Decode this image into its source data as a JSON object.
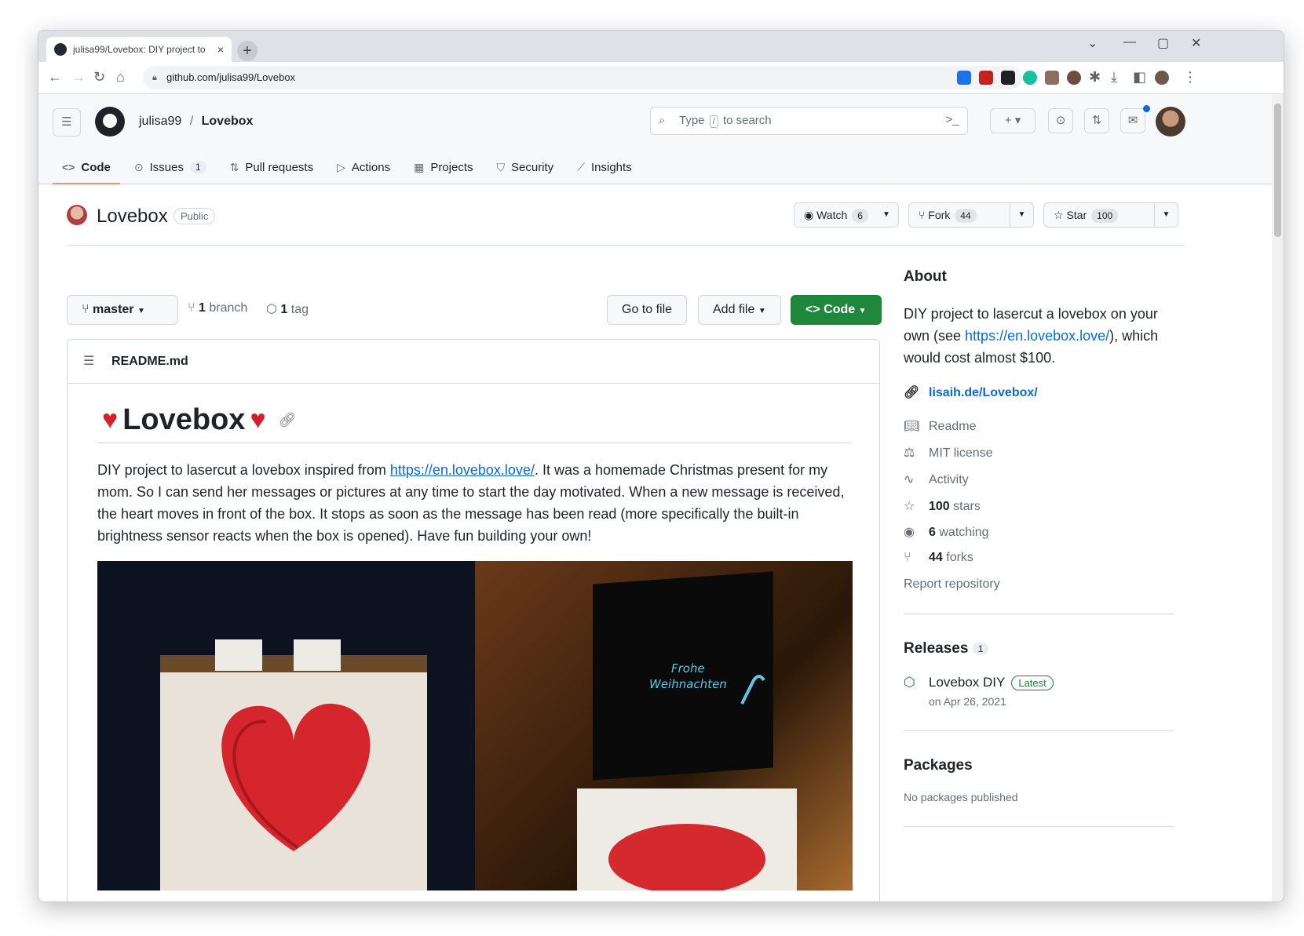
{
  "browser": {
    "tab_title": "julisa99/Lovebox: DIY project to",
    "tab_close": "×",
    "new_tab": "+",
    "url": "github.com/julisa99/Lovebox",
    "minimize": "⌄",
    "min2": "—",
    "maximize": "▢",
    "close": "✕"
  },
  "header": {
    "owner": "julisa99",
    "sep": "/",
    "repo": "Lovebox",
    "search_prefix": "Type",
    "search_kbd": "/",
    "search_suffix": "to search"
  },
  "repo_tabs": [
    {
      "icon": "<>",
      "label": "Code",
      "selected": true
    },
    {
      "icon": "⊙",
      "label": "Issues",
      "count": "1"
    },
    {
      "icon": "⇅",
      "label": "Pull requests"
    },
    {
      "icon": "▷",
      "label": "Actions"
    },
    {
      "icon": "▦",
      "label": "Projects"
    },
    {
      "icon": "⛉",
      "label": "Security"
    },
    {
      "icon": "⟋",
      "label": "Insights"
    }
  ],
  "repo": {
    "name": "Lovebox",
    "visibility": "Public",
    "watch_label": "Watch",
    "watch_count": "6",
    "fork_label": "Fork",
    "fork_count": "44",
    "star_label": "Star",
    "star_count": "100"
  },
  "filebar": {
    "branch": "master",
    "branch_count": "1",
    "branch_word": "branch",
    "tag_count": "1",
    "tag_word": "tag",
    "go_to_file": "Go to file",
    "add_file": "Add file",
    "code": "Code"
  },
  "readme": {
    "filename": "README.md",
    "title": "Lovebox",
    "para_before": "DIY project to lasercut a lovebox inspired from ",
    "para_link": "https://en.lovebox.love/",
    "para_after": ". It was a homemade Christmas present for my mom. So I can send her messages or pictures at any time to start the day motivated. When a new message is received, the heart moves in front of the box. It stops as soon as the message has been read (more specifically the built-in brightness sensor reacts when the box is opened). Have fun building your own!",
    "image_text_1": "Frohe",
    "image_text_2": "Weihnachten"
  },
  "about": {
    "heading": "About",
    "desc_before": "DIY project to lasercut a lovebox on your own (see ",
    "desc_link": "https://en.lovebox.love/",
    "desc_after": "), which would cost almost $100.",
    "website": "lisaih.de/Lovebox/",
    "readme": "Readme",
    "license": "MIT license",
    "activity": "Activity",
    "stars_count": "100",
    "stars_word": "stars",
    "watching_count": "6",
    "watching_word": "watching",
    "forks_count": "44",
    "forks_word": "forks",
    "report": "Report repository"
  },
  "releases": {
    "heading": "Releases",
    "count": "1",
    "name": "Lovebox DIY",
    "badge": "Latest",
    "date": "on Apr 26, 2021"
  },
  "packages": {
    "heading": "Packages",
    "empty": "No packages published"
  }
}
